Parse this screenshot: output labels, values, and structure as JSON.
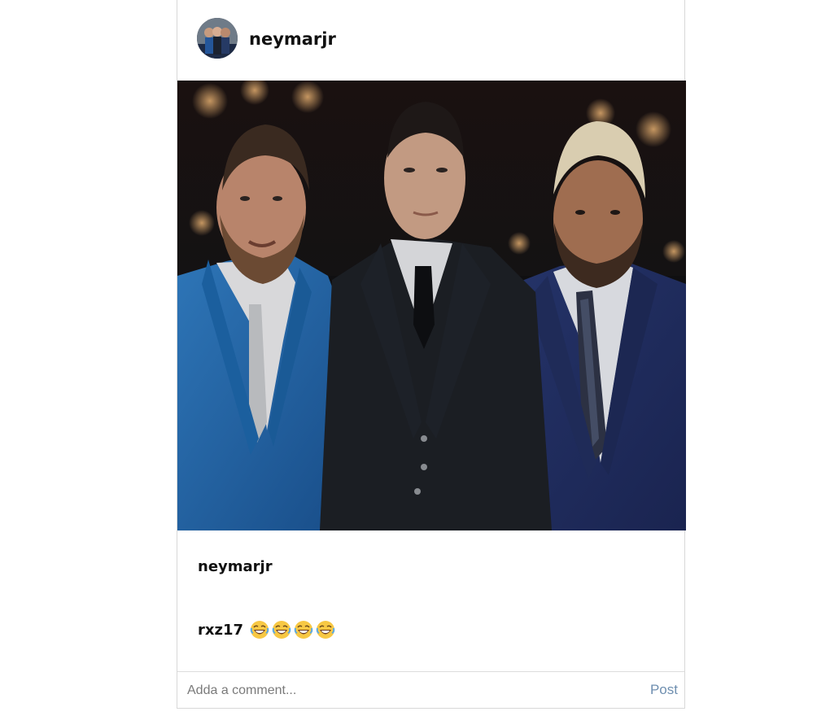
{
  "post": {
    "author": "neymarjr",
    "avatar_icon": "profile-avatar-icon",
    "caption_user": "neymarjr",
    "comments": [
      {
        "user": "rxz17",
        "emojis": [
          "😂",
          "😂",
          "😂",
          "😂"
        ]
      }
    ],
    "comment_placeholder": "Adda a comment...",
    "post_label": "Post",
    "photo_alt": "Three men in suits"
  },
  "colors": {
    "post_link": "#6f8fb0",
    "border": "#d8d8d8",
    "text": "#111111"
  }
}
